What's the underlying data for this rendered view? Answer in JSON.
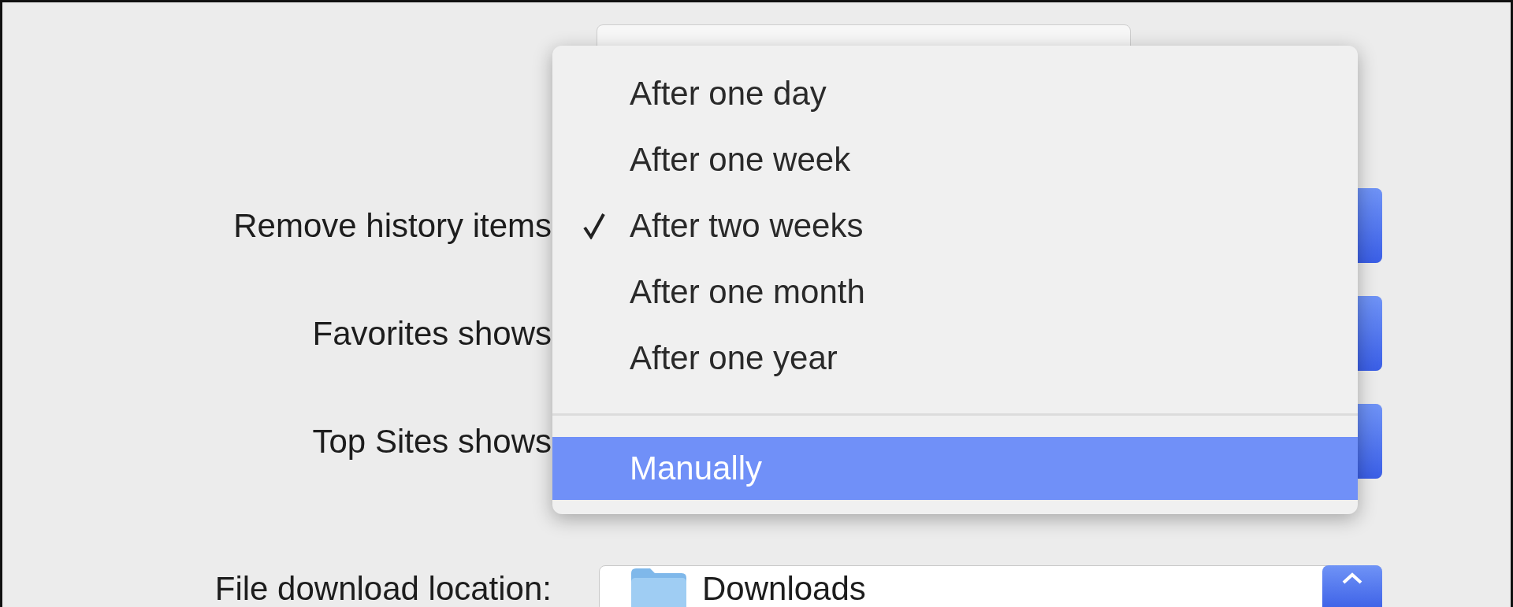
{
  "rows": [
    {
      "kind": "popup",
      "label": "Remove history items"
    },
    {
      "kind": "popup",
      "label": "Favorites shows"
    },
    {
      "kind": "popup",
      "label": "Top Sites shows"
    },
    {
      "kind": "folder",
      "label": "File download location:",
      "value": "Downloads"
    }
  ],
  "menu": {
    "items": [
      {
        "kind": "option",
        "label": "After one day",
        "checked": false,
        "selected": false
      },
      {
        "kind": "option",
        "label": "After one week",
        "checked": false,
        "selected": false
      },
      {
        "kind": "option",
        "label": "After two weeks",
        "checked": true,
        "selected": false
      },
      {
        "kind": "option",
        "label": "After one month",
        "checked": false,
        "selected": false
      },
      {
        "kind": "option",
        "label": "After one year",
        "checked": false,
        "selected": false
      },
      {
        "kind": "separator"
      },
      {
        "kind": "option",
        "label": "Manually",
        "checked": false,
        "selected": true
      }
    ]
  }
}
